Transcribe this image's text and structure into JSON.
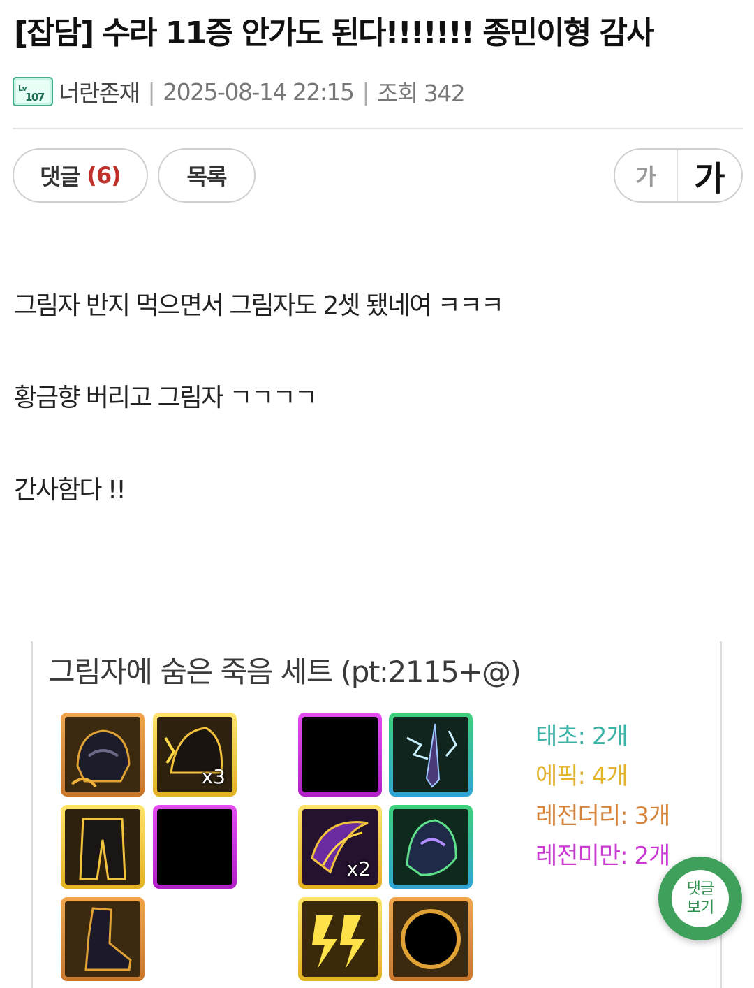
{
  "post": {
    "title": "[잡담] 수라 11증 안가도 된다!!!!!!! 종민이형 감사",
    "author": "너란존재",
    "datetime": "2025-08-14 22:15",
    "views_label": "조회 342",
    "level_badge_icon": "level-107-badge-icon"
  },
  "actions": {
    "comment_label": "댓글",
    "comment_count": "(6)",
    "list_label": "목록",
    "font_small": "가",
    "font_large": "가"
  },
  "content": {
    "lines": [
      "그림자 반지 먹으면서 그림자도 2셋 됐네여 ㅋㅋㅋ",
      "황금향 버리고 그림자 ㄱㄱㄱㄱ",
      "간사함다 !!"
    ]
  },
  "set_card": {
    "title": "그림자에 숨은 죽음 세트 (pt:2115+@)",
    "left_slots": [
      {
        "rarity": "legendary",
        "icon": "helmet-icon"
      },
      {
        "rarity": "epic",
        "icon": "shoulder-icon",
        "qty": "x3"
      },
      {
        "rarity": "epic",
        "icon": "pants-icon"
      },
      {
        "rarity": "missing",
        "icon": "empty-slot-icon"
      },
      {
        "rarity": "legendary",
        "icon": "boots-icon"
      }
    ],
    "right_slots": [
      {
        "rarity": "missing",
        "icon": "empty-slot-icon"
      },
      {
        "rarity": "primeval",
        "icon": "necklace-icon"
      },
      {
        "rarity": "epic",
        "icon": "ring-icon",
        "qty": "x2"
      },
      {
        "rarity": "primeval",
        "icon": "cloak-icon"
      },
      {
        "rarity": "epic",
        "icon": "lightning-icon"
      },
      {
        "rarity": "legendary",
        "icon": "orb-icon"
      }
    ],
    "stats": [
      {
        "label": "태초: 2개",
        "color": "#3bb3a6"
      },
      {
        "label": "에픽: 4개",
        "color": "#e3b32e"
      },
      {
        "label": "레전더리: 3개",
        "color": "#d5843d"
      },
      {
        "label": "레전미만: 2개",
        "color": "#c93ad0"
      }
    ]
  },
  "floating_button": {
    "line1": "댓글",
    "line2": "보기"
  },
  "colors": {
    "accent_red": "#c0302a",
    "float_green": "#3ea05a"
  }
}
